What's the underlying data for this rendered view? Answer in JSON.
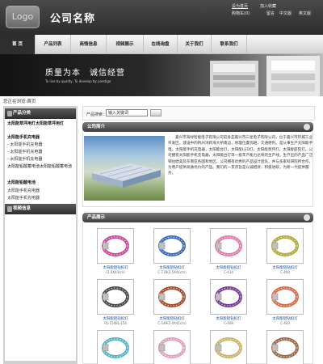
{
  "header": {
    "logo": "Logo",
    "company": "公司名称",
    "links": {
      "home": "设为首页",
      "favorite": "加入收藏",
      "shop": "购物车(0)",
      "message": "留言",
      "chinese": "中文版",
      "english": "英文版"
    }
  },
  "nav": {
    "items": [
      "首 页",
      "产品列表",
      "商情信息",
      "视频展示",
      "在线询盘",
      "关于我们",
      "联系我们"
    ],
    "active": 0
  },
  "banner": {
    "title": "质量为本　诚信经营",
    "subtitle": "To live by quality, To develop by prestige"
  },
  "breadcrumb": "您正在浏览:首页",
  "sidebar": {
    "category_title": "产品分类",
    "categories": [
      {
        "label": "太阳能草坪用灯太阳能草坪用灯",
        "level": "main"
      },
      {
        "label": "太阳能手机充电器",
        "level": "main"
      },
      {
        "label": "- 太阳能手机充电器",
        "level": "sub"
      },
      {
        "label": "- 太阳能手机充电器",
        "level": "sub"
      },
      {
        "label": "- 太阳能手机充电器",
        "level": "sub"
      },
      {
        "label": "太阳能铅酸蓄电池太阳能铅酸蓄电池",
        "level": "main"
      },
      {
        "label": "太阳能铅酸电池",
        "level": "main"
      },
      {
        "label": "太阳能手机充电器",
        "level": "sub"
      },
      {
        "label": "太阳能手机充电器",
        "level": "sub"
      }
    ],
    "video_title": "视频信息"
  },
  "search": {
    "label": "产品搜索：",
    "placeholder": "输入关键词"
  },
  "intro": {
    "title": "公司简介",
    "text": "嘉兴市海绿智能电子有限公司前身是嘉兴市三星电子有限公司，位于嘉兴市环城工业开发区，建设中的杭州湾跨海大桥南边，地理位置优越，交通便利。是从事生产太阳能手电，太阳能手机充电器，太阳能台灯，太阳能LED灯，太阳能草坪灯，太阳能庭院灯。公司拥有太阳能手机充电器，太阳能台灯等一批年产能力达到的生产线，生产出的产品广泛销往欧美及东南亚各国和地区。公司拥有优秀的产品设计团队，并与多家科研院所合作，为用户提供高质优价的产品。我们的一贯宗旨是以诚相待，积极进取，为新一代提供服务。"
  },
  "products": {
    "title": "产品展示",
    "items": [
      {
        "name": "太阳能铝钻扣灯",
        "code": "(2.0X43cm)"
      },
      {
        "name": "太阳能铝钻扣灯",
        "code": "C-178(2.5X41cm)"
      },
      {
        "name": "太阳能铝钻扣灯",
        "code": "C-414"
      },
      {
        "name": "太阳能铝钻扣灯",
        "code": "C-400"
      },
      {
        "name": "太阳能铝钻扣灯",
        "code": "RL-1548L-154"
      },
      {
        "name": "太阳能铝钻扣灯",
        "code": "C-149(2.0X41cm)"
      },
      {
        "name": "太阳能铝钻扣灯",
        "code": "C-409"
      },
      {
        "name": "太阳能铝钻扣灯",
        "code": "C-403"
      },
      {
        "name": "",
        "code": ""
      },
      {
        "name": "",
        "code": ""
      },
      {
        "name": "",
        "code": ""
      },
      {
        "name": "",
        "code": ""
      }
    ]
  },
  "colors": {
    "header": "#2c2c2c",
    "nav_active": "#2e2e2e",
    "panel_header": "#3e3e3e",
    "link": "#1a4fa0"
  },
  "icons": {
    "more": "more-icon",
    "search_button": "search-button-icon"
  }
}
